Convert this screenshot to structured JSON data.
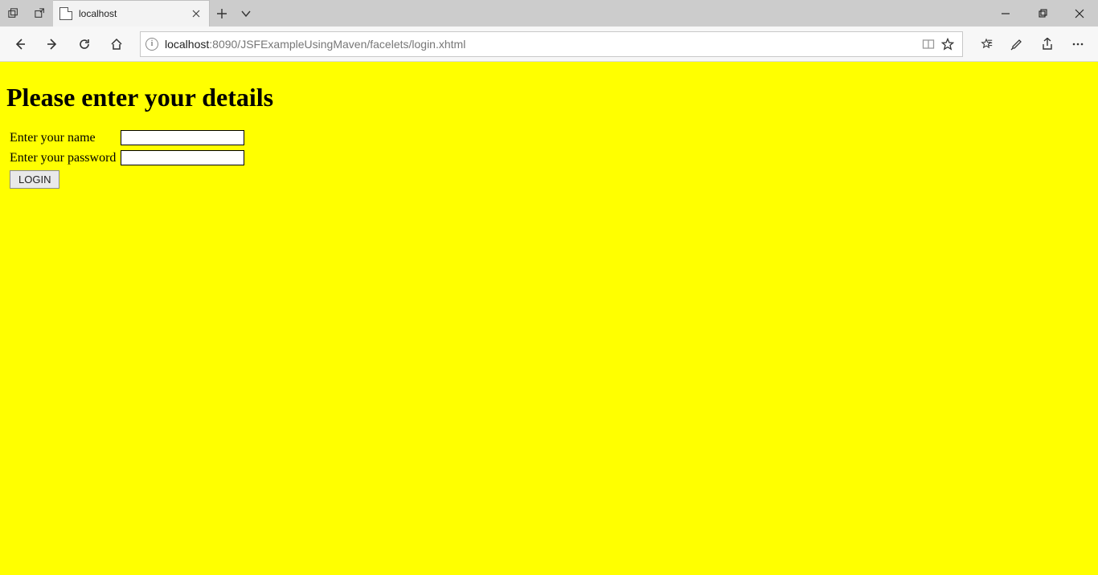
{
  "browser": {
    "tab_title": "localhost",
    "url": {
      "host": "localhost",
      "rest": ":8090/JSFExampleUsingMaven/facelets/login.xhtml"
    }
  },
  "page": {
    "heading": "Please enter your details",
    "form": {
      "name_label": "Enter your name",
      "name_value": "",
      "password_label": "Enter your password",
      "password_value": "",
      "submit_label": "LOGIN"
    }
  }
}
